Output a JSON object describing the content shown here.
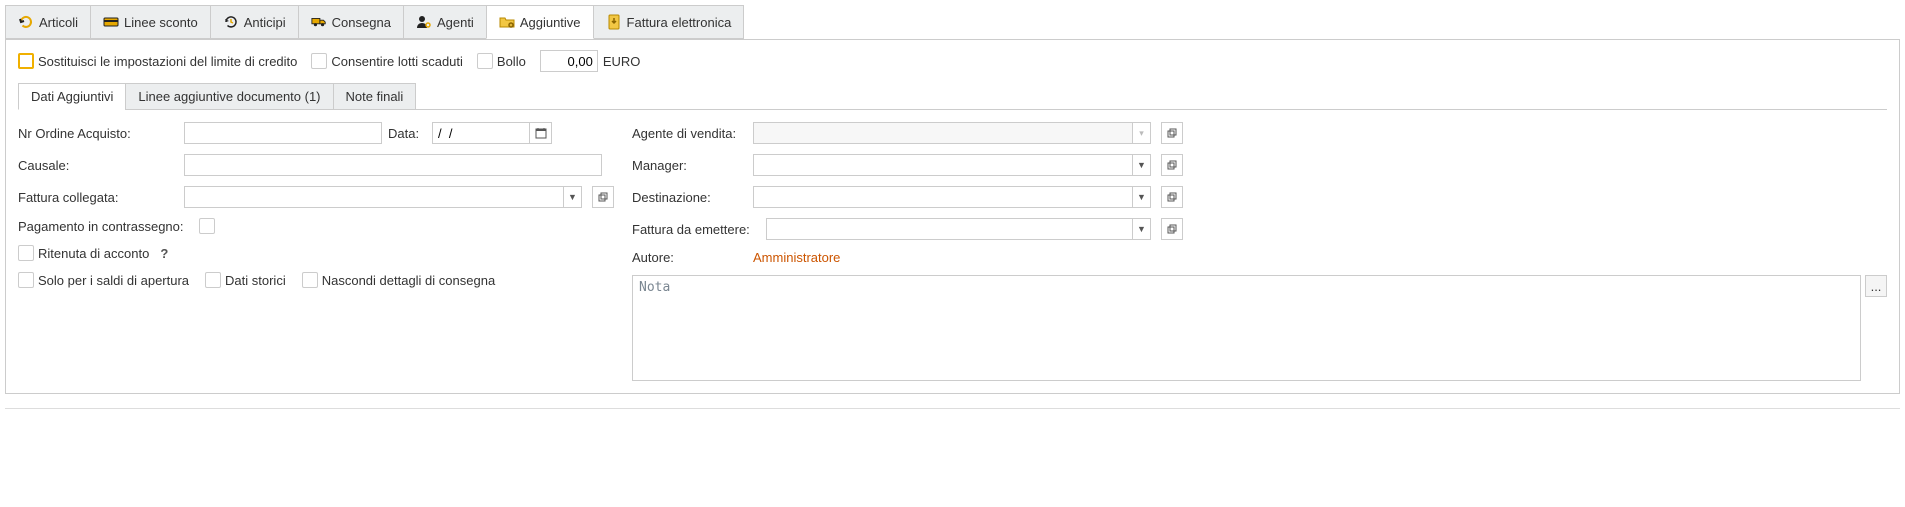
{
  "topTabs": {
    "articoli": "Articoli",
    "lineeSconto": "Linee sconto",
    "anticipi": "Anticipi",
    "consegna": "Consegna",
    "agenti": "Agenti",
    "aggiuntive": "Aggiuntive",
    "fatturaElettronica": "Fattura elettronica"
  },
  "topControls": {
    "sostituisci": "Sostituisci le impostazioni del limite di credito",
    "consentireLotti": "Consentire lotti scaduti",
    "bollo": "Bollo",
    "bolloValue": "0,00",
    "currency": "EURO"
  },
  "innerTabs": {
    "datiAggiuntivi": "Dati Aggiuntivi",
    "lineeAggiuntive": "Linee aggiuntive documento (1)",
    "noteFinali": "Note finali"
  },
  "left": {
    "nrOrdineAcquistoLabel": "Nr Ordine Acquisto:",
    "dataLabel": "Data:",
    "dataValue": "/  /",
    "causaleLabel": "Causale:",
    "fatturaCollegataLabel": "Fattura collegata:",
    "pagamentoContrassegnoLabel": "Pagamento in contrassegno:",
    "ritenutaAccontoLabel": "Ritenuta di acconto",
    "soloSaldiApertura": "Solo per i saldi di apertura",
    "datiStorici": "Dati storici",
    "nascondiDettagli": "Nascondi dettagli di consegna"
  },
  "right": {
    "agenteVenditaLabel": "Agente di vendita:",
    "managerLabel": "Manager:",
    "destinazioneLabel": "Destinazione:",
    "fatturaDaEmettereLabel": "Fattura da emettere:",
    "autoreLabel": "Autore:",
    "autoreValue": "Amministratore",
    "notaPlaceholder": "Nota",
    "moreBtn": "..."
  }
}
